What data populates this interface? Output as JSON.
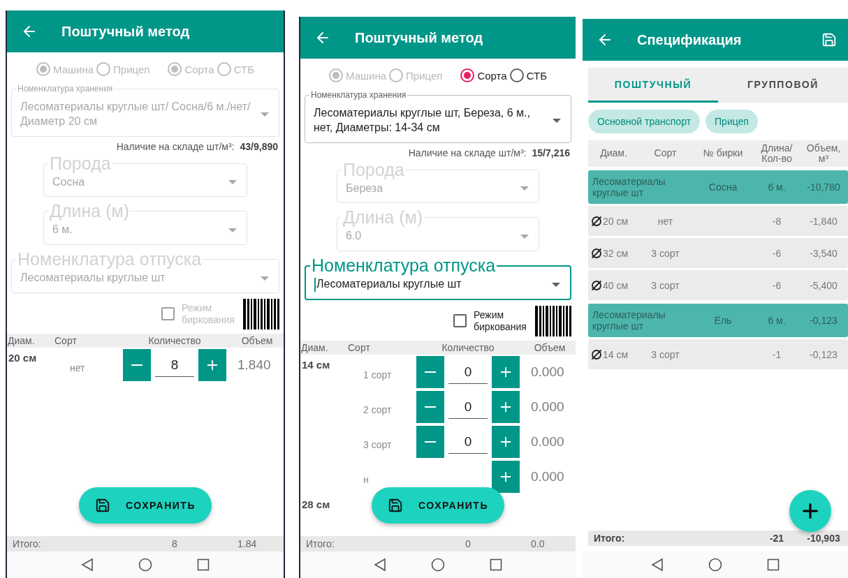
{
  "screens": [
    {
      "kind": "entry",
      "title": "Поштучный метод",
      "radio_groups": [
        {
          "options": [
            {
              "label": "Машина",
              "selected": true,
              "disabled": true
            },
            {
              "label": "Прицеп",
              "selected": false,
              "disabled": true
            }
          ]
        },
        {
          "options": [
            {
              "label": "Сорта",
              "selected": true,
              "disabled": true
            },
            {
              "label": "СТБ",
              "selected": false,
              "disabled": true
            }
          ]
        }
      ],
      "storage": {
        "label": "Номенклатура хранения",
        "value": "Лесоматериалы круглые шт/ Сосна/6 м./нет/Диаметр 20 см",
        "disabled": true
      },
      "stock": {
        "label": "Наличие на складе шт/м³:",
        "value": "43/9,890"
      },
      "species": {
        "label": "Порода",
        "value": "Сосна",
        "disabled": true
      },
      "length": {
        "label": "Длина (м)",
        "value": "6 м.",
        "disabled": true
      },
      "release": {
        "label": "Номенклатура отпуска",
        "value": "Лесоматериалы круглые шт",
        "disabled": true,
        "focused": false
      },
      "tagging": {
        "label": "Режим биркования",
        "checked": false,
        "disabled": true
      },
      "columns": [
        "Диам.",
        "Сорт",
        "Количество",
        "Объем"
      ],
      "groups": [
        {
          "diameter": "20 см",
          "rows": [
            {
              "grade": "нет",
              "qty": "8",
              "volume": "1.840"
            }
          ]
        }
      ],
      "save_label": "СОХРАНИТЬ",
      "total": {
        "label": "Итого:",
        "qty": "8",
        "volume": "1.84"
      }
    },
    {
      "kind": "entry",
      "title": "Поштучный метод",
      "radio_groups": [
        {
          "options": [
            {
              "label": "Машина",
              "selected": true,
              "disabled": true
            },
            {
              "label": "Прицеп",
              "selected": false,
              "disabled": true
            }
          ]
        },
        {
          "options": [
            {
              "label": "Сорта",
              "selected": true,
              "disabled": false
            },
            {
              "label": "СТБ",
              "selected": false,
              "disabled": false
            }
          ]
        }
      ],
      "storage": {
        "label": "Номенклатура хранения",
        "value": "Лесоматериалы круглые шт, Береза, 6 м., нет, Диаметры: 14-34 см",
        "disabled": false
      },
      "stock": {
        "label": "Наличие на складе шт/м³:",
        "value": "15/7,216"
      },
      "species": {
        "label": "Порода",
        "value": "Береза",
        "disabled": true
      },
      "length": {
        "label": "Длина (м)",
        "value": "6.0",
        "disabled": true
      },
      "release": {
        "label": "Номенклатура отпуска",
        "value": "Лесоматериалы круглые шт",
        "disabled": false,
        "focused": true
      },
      "tagging": {
        "label": "Режим биркования",
        "checked": false,
        "disabled": false
      },
      "columns": [
        "Диам.",
        "Сорт",
        "Количество",
        "Объем"
      ],
      "groups": [
        {
          "diameter": "14 см",
          "rows": [
            {
              "grade": "1 сорт",
              "qty": "0",
              "volume": "0.000"
            },
            {
              "grade": "2 сорт",
              "qty": "0",
              "volume": "0.000"
            },
            {
              "grade": "3 сорт",
              "qty": "0",
              "volume": "0.000"
            },
            {
              "grade": "н",
              "volume": "0.000"
            }
          ]
        },
        {
          "diameter": "28 см"
        }
      ],
      "save_label": "СОХРАНИТЬ",
      "total": {
        "label": "Итого:",
        "qty": "0",
        "volume": "0.0"
      }
    },
    {
      "kind": "spec",
      "title": "Спецификация",
      "tabs": [
        {
          "label": "ПОШТУЧНЫЙ",
          "selected": true
        },
        {
          "label": "ГРУППОВОЙ",
          "selected": false
        }
      ],
      "chips": [
        "Основной транспорт",
        "Прицеп"
      ],
      "columns": [
        "Диам.",
        "Сорт",
        "№ бирки",
        "Длина/ Кол-во",
        "Объем, м³"
      ],
      "rows": [
        {
          "kind": "group",
          "name": "Лесоматериалы круглые шт",
          "species": "Сосна",
          "length": "6 м.",
          "volume": "-10,780"
        },
        {
          "kind": "item",
          "diameter": "20 см",
          "grade": "нет",
          "qty": "-8",
          "volume": "-1,840"
        },
        {
          "kind": "item",
          "diameter": "32 см",
          "grade": "3 сорт",
          "qty": "-6",
          "volume": "-3,540"
        },
        {
          "kind": "item",
          "diameter": "40 см",
          "grade": "3 сорт",
          "qty": "-6",
          "volume": "-5,400"
        },
        {
          "kind": "group",
          "name": "Лесоматериалы круглые шт",
          "species": "Ель",
          "length": "6 м.",
          "volume": "-0,123"
        },
        {
          "kind": "item",
          "diameter": "14 см",
          "grade": "3 сорт",
          "qty": "-1",
          "volume": "-0,123"
        }
      ],
      "total": {
        "label": "Итого:",
        "qty": "-21",
        "volume": "-10,903"
      }
    }
  ]
}
